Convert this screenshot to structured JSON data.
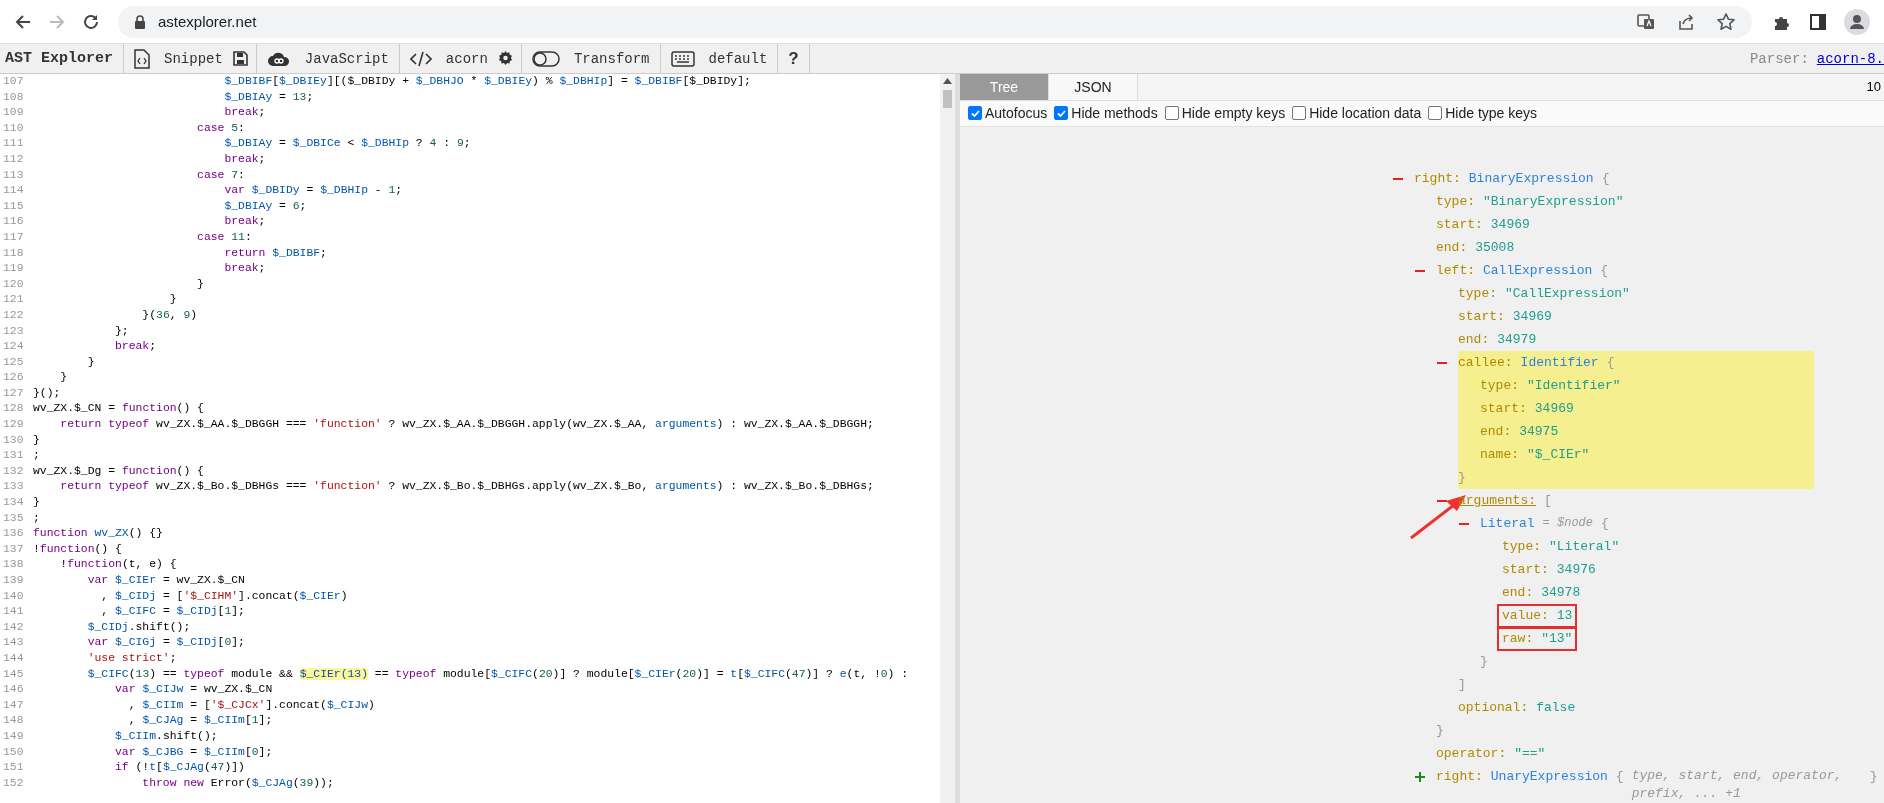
{
  "browser": {
    "nav": [
      {
        "kind": "back",
        "disabled": false
      },
      {
        "kind": "forward",
        "disabled": true
      },
      {
        "kind": "reload",
        "disabled": false
      }
    ],
    "url": "astexplorer.net",
    "actions": [
      {
        "kind": "translate"
      },
      {
        "kind": "share"
      },
      {
        "kind": "star"
      },
      {
        "kind": "extensions"
      },
      {
        "kind": "sidebar"
      },
      {
        "kind": "profile"
      }
    ]
  },
  "app_title": "AST Explorer",
  "toolbar": [
    [
      {
        "kind": "snippet",
        "label": "Snippet"
      },
      {
        "kind": "save"
      }
    ],
    [
      {
        "kind": "language",
        "label": "JavaScript"
      }
    ],
    [
      {
        "kind": "parser",
        "label": "acorn"
      },
      {
        "kind": "settings"
      }
    ],
    [
      {
        "kind": "transform",
        "label": "Transform"
      }
    ],
    [
      {
        "kind": "keymap",
        "label": "default"
      }
    ],
    [
      {
        "kind": "help",
        "label": "?"
      }
    ]
  ],
  "parser": {
    "label": "Parser:",
    "link": "acorn-8."
  },
  "code_lines": [
    {
      "no": "107",
      "seg": [
        {
          "kind": "v",
          "text": "                            $_DBIBF"
        },
        {
          "kind": "p",
          "text": "["
        },
        {
          "kind": "v",
          "text": "$_DBIEy"
        },
        {
          "kind": "p",
          "text": "][($_DBIDy + "
        },
        {
          "kind": "v",
          "text": "$_DBHJO"
        },
        {
          "kind": "p",
          "text": " * "
        },
        {
          "kind": "v",
          "text": "$_DBIEy"
        },
        {
          "kind": "p",
          "text": ") % "
        },
        {
          "kind": "v",
          "text": "$_DBHIp"
        },
        {
          "kind": "p",
          "text": "] = "
        },
        {
          "kind": "v",
          "text": "$_DBIBF"
        },
        {
          "kind": "p",
          "text": "[$_DBIDy];"
        }
      ]
    },
    {
      "no": "108",
      "seg": [
        {
          "kind": "v",
          "text": "                            $_DBIAy"
        },
        {
          "kind": "p",
          "text": " = "
        },
        {
          "kind": "n",
          "text": "13"
        },
        {
          "kind": "p",
          "text": ";"
        }
      ]
    },
    {
      "no": "109",
      "seg": [
        {
          "kind": "k",
          "text": "                            break"
        },
        {
          "kind": "p",
          "text": ";"
        }
      ]
    },
    {
      "no": "110",
      "seg": [
        {
          "kind": "k",
          "text": "                        case "
        },
        {
          "kind": "n",
          "text": "5"
        },
        {
          "kind": "p",
          "text": ":"
        }
      ]
    },
    {
      "no": "111",
      "seg": [
        {
          "kind": "v",
          "text": "                            $_DBIAy"
        },
        {
          "kind": "p",
          "text": " = "
        },
        {
          "kind": "v",
          "text": "$_DBICe"
        },
        {
          "kind": "p",
          "text": " < "
        },
        {
          "kind": "v",
          "text": "$_DBHIp"
        },
        {
          "kind": "p",
          "text": " ? "
        },
        {
          "kind": "n",
          "text": "4"
        },
        {
          "kind": "p",
          "text": " : "
        },
        {
          "kind": "n",
          "text": "9"
        },
        {
          "kind": "p",
          "text": ";"
        }
      ]
    },
    {
      "no": "112",
      "seg": [
        {
          "kind": "k",
          "text": "                            break"
        },
        {
          "kind": "p",
          "text": ";"
        }
      ]
    },
    {
      "no": "113",
      "seg": [
        {
          "kind": "k",
          "text": "                        case "
        },
        {
          "kind": "n",
          "text": "7"
        },
        {
          "kind": "p",
          "text": ":"
        }
      ]
    },
    {
      "no": "114",
      "seg": [
        {
          "kind": "k",
          "text": "                            var "
        },
        {
          "kind": "v",
          "text": "$_DBIDy"
        },
        {
          "kind": "p",
          "text": " = "
        },
        {
          "kind": "v",
          "text": "$_DBHIp"
        },
        {
          "kind": "p",
          "text": " - "
        },
        {
          "kind": "n",
          "text": "1"
        },
        {
          "kind": "p",
          "text": ";"
        }
      ]
    },
    {
      "no": "115",
      "seg": [
        {
          "kind": "v",
          "text": "                            $_DBIAy"
        },
        {
          "kind": "p",
          "text": " = "
        },
        {
          "kind": "n",
          "text": "6"
        },
        {
          "kind": "p",
          "text": ";"
        }
      ]
    },
    {
      "no": "116",
      "seg": [
        {
          "kind": "k",
          "text": "                            break"
        },
        {
          "kind": "p",
          "text": ";"
        }
      ]
    },
    {
      "no": "117",
      "seg": [
        {
          "kind": "k",
          "text": "                        case "
        },
        {
          "kind": "n",
          "text": "11"
        },
        {
          "kind": "p",
          "text": ":"
        }
      ]
    },
    {
      "no": "118",
      "seg": [
        {
          "kind": "k",
          "text": "                            return "
        },
        {
          "kind": "v",
          "text": "$_DBIBF"
        },
        {
          "kind": "p",
          "text": ";"
        }
      ]
    },
    {
      "no": "119",
      "seg": [
        {
          "kind": "k",
          "text": "                            break"
        },
        {
          "kind": "p",
          "text": ";"
        }
      ]
    },
    {
      "no": "120",
      "seg": [
        {
          "kind": "p",
          "text": "                        }"
        }
      ]
    },
    {
      "no": "121",
      "seg": [
        {
          "kind": "p",
          "text": "                    }"
        }
      ]
    },
    {
      "no": "122",
      "seg": [
        {
          "kind": "p",
          "text": "                }("
        },
        {
          "kind": "n",
          "text": "36"
        },
        {
          "kind": "p",
          "text": ", "
        },
        {
          "kind": "n",
          "text": "9"
        },
        {
          "kind": "p",
          "text": ")"
        }
      ]
    },
    {
      "no": "123",
      "seg": [
        {
          "kind": "p",
          "text": "            };"
        }
      ]
    },
    {
      "no": "124",
      "seg": [
        {
          "kind": "k",
          "text": "            break"
        },
        {
          "kind": "p",
          "text": ";"
        }
      ]
    },
    {
      "no": "125",
      "seg": [
        {
          "kind": "p",
          "text": "        }"
        }
      ]
    },
    {
      "no": "126",
      "seg": [
        {
          "kind": "p",
          "text": "    }"
        }
      ]
    },
    {
      "no": "127",
      "seg": [
        {
          "kind": "p",
          "text": "}();"
        }
      ]
    },
    {
      "no": "128",
      "seg": [
        {
          "kind": "p",
          "text": "wv_ZX.$_CN = "
        },
        {
          "kind": "k",
          "text": "function"
        },
        {
          "kind": "p",
          "text": "() {"
        }
      ]
    },
    {
      "no": "129",
      "seg": [
        {
          "kind": "k",
          "text": "    return typeof"
        },
        {
          "kind": "p",
          "text": " wv_ZX.$_AA.$_DBGGH === "
        },
        {
          "kind": "s",
          "text": "'function'"
        },
        {
          "kind": "p",
          "text": " ? wv_ZX.$_AA.$_DBGGH.apply(wv_ZX.$_AA, "
        },
        {
          "kind": "v",
          "text": "arguments"
        },
        {
          "kind": "p",
          "text": ") : wv_ZX.$_AA.$_DBGGH;"
        }
      ]
    },
    {
      "no": "130",
      "seg": [
        {
          "kind": "p",
          "text": "}"
        }
      ]
    },
    {
      "no": "131",
      "seg": [
        {
          "kind": "p",
          "text": ";"
        }
      ]
    },
    {
      "no": "132",
      "seg": [
        {
          "kind": "p",
          "text": "wv_ZX.$_Dg = "
        },
        {
          "kind": "k",
          "text": "function"
        },
        {
          "kind": "p",
          "text": "() {"
        }
      ]
    },
    {
      "no": "133",
      "seg": [
        {
          "kind": "k",
          "text": "    return typeof"
        },
        {
          "kind": "p",
          "text": " wv_ZX.$_Bo.$_DBHGs === "
        },
        {
          "kind": "s",
          "text": "'function'"
        },
        {
          "kind": "p",
          "text": " ? wv_ZX.$_Bo.$_DBHGs.apply(wv_ZX.$_Bo, "
        },
        {
          "kind": "v",
          "text": "arguments"
        },
        {
          "kind": "p",
          "text": ") : wv_ZX.$_Bo.$_DBHGs;"
        }
      ]
    },
    {
      "no": "134",
      "seg": [
        {
          "kind": "p",
          "text": "}"
        }
      ]
    },
    {
      "no": "135",
      "seg": [
        {
          "kind": "p",
          "text": ";"
        }
      ]
    },
    {
      "no": "136",
      "seg": [
        {
          "kind": "k",
          "text": "function "
        },
        {
          "kind": "v",
          "text": "wv_ZX"
        },
        {
          "kind": "p",
          "text": "() {}"
        }
      ]
    },
    {
      "no": "137",
      "seg": [
        {
          "kind": "p",
          "text": "!"
        },
        {
          "kind": "k",
          "text": "function"
        },
        {
          "kind": "p",
          "text": "() {"
        }
      ]
    },
    {
      "no": "138",
      "seg": [
        {
          "kind": "p",
          "text": "    !"
        },
        {
          "kind": "k",
          "text": "function"
        },
        {
          "kind": "p",
          "text": "(t, e) {"
        }
      ]
    },
    {
      "no": "139",
      "seg": [
        {
          "kind": "k",
          "text": "        var "
        },
        {
          "kind": "v",
          "text": "$_CIEr"
        },
        {
          "kind": "p",
          "text": " = wv_ZX.$_CN"
        }
      ]
    },
    {
      "no": "140",
      "seg": [
        {
          "kind": "p",
          "text": "          , "
        },
        {
          "kind": "v",
          "text": "$_CIDj"
        },
        {
          "kind": "p",
          "text": " = ["
        },
        {
          "kind": "s",
          "text": "'$_CIHM'"
        },
        {
          "kind": "p",
          "text": "].concat("
        },
        {
          "kind": "v",
          "text": "$_CIEr"
        },
        {
          "kind": "p",
          "text": ")"
        }
      ]
    },
    {
      "no": "141",
      "seg": [
        {
          "kind": "p",
          "text": "          , "
        },
        {
          "kind": "v",
          "text": "$_CIFC"
        },
        {
          "kind": "p",
          "text": " = "
        },
        {
          "kind": "v",
          "text": "$_CIDj"
        },
        {
          "kind": "p",
          "text": "["
        },
        {
          "kind": "n",
          "text": "1"
        },
        {
          "kind": "p",
          "text": "];"
        }
      ]
    },
    {
      "no": "142",
      "seg": [
        {
          "kind": "v",
          "text": "        $_CIDj"
        },
        {
          "kind": "p",
          "text": ".shift();"
        }
      ]
    },
    {
      "no": "143",
      "seg": [
        {
          "kind": "k",
          "text": "        var "
        },
        {
          "kind": "v",
          "text": "$_CIGj"
        },
        {
          "kind": "p",
          "text": " = "
        },
        {
          "kind": "v",
          "text": "$_CIDj"
        },
        {
          "kind": "p",
          "text": "["
        },
        {
          "kind": "n",
          "text": "0"
        },
        {
          "kind": "p",
          "text": "];"
        }
      ]
    },
    {
      "no": "144",
      "seg": [
        {
          "kind": "s",
          "text": "        'use strict'"
        },
        {
          "kind": "p",
          "text": ";"
        }
      ]
    },
    {
      "no": "145",
      "seg": [
        {
          "kind": "v",
          "text": "        $_CIFC"
        },
        {
          "kind": "p",
          "text": "("
        },
        {
          "kind": "n",
          "text": "13"
        },
        {
          "kind": "p",
          "text": ") == "
        },
        {
          "kind": "k",
          "text": "typeof"
        },
        {
          "kind": "p",
          "text": " module && "
        },
        {
          "kind": "h",
          "text": "$_CIEr(13)"
        },
        {
          "kind": "p",
          "text": " == "
        },
        {
          "kind": "k",
          "text": "typeof"
        },
        {
          "kind": "p",
          "text": " module["
        },
        {
          "kind": "v",
          "text": "$_CIFC"
        },
        {
          "kind": "p",
          "text": "("
        },
        {
          "kind": "n",
          "text": "20"
        },
        {
          "kind": "p",
          "text": ")] ? module["
        },
        {
          "kind": "v",
          "text": "$_CIEr"
        },
        {
          "kind": "p",
          "text": "("
        },
        {
          "kind": "n",
          "text": "20"
        },
        {
          "kind": "p",
          "text": ")] = "
        },
        {
          "kind": "v",
          "text": "t"
        },
        {
          "kind": "p",
          "text": "["
        },
        {
          "kind": "v",
          "text": "$_CIFC"
        },
        {
          "kind": "p",
          "text": "("
        },
        {
          "kind": "n",
          "text": "47"
        },
        {
          "kind": "p",
          "text": ")] ? "
        },
        {
          "kind": "v",
          "text": "e"
        },
        {
          "kind": "p",
          "text": "(t, !"
        },
        {
          "kind": "n",
          "text": "0"
        },
        {
          "kind": "p",
          "text": ") :"
        }
      ]
    },
    {
      "no": "146",
      "seg": [
        {
          "kind": "k",
          "text": "            var "
        },
        {
          "kind": "v",
          "text": "$_CIJw"
        },
        {
          "kind": "p",
          "text": " = wv_ZX.$_CN"
        }
      ]
    },
    {
      "no": "147",
      "seg": [
        {
          "kind": "p",
          "text": "              , "
        },
        {
          "kind": "v",
          "text": "$_CIIm"
        },
        {
          "kind": "p",
          "text": " = ["
        },
        {
          "kind": "s",
          "text": "'$_CJCx'"
        },
        {
          "kind": "p",
          "text": "].concat("
        },
        {
          "kind": "v",
          "text": "$_CIJw"
        },
        {
          "kind": "p",
          "text": ")"
        }
      ]
    },
    {
      "no": "148",
      "seg": [
        {
          "kind": "p",
          "text": "              , "
        },
        {
          "kind": "v",
          "text": "$_CJAg"
        },
        {
          "kind": "p",
          "text": " = "
        },
        {
          "kind": "v",
          "text": "$_CIIm"
        },
        {
          "kind": "p",
          "text": "["
        },
        {
          "kind": "n",
          "text": "1"
        },
        {
          "kind": "p",
          "text": "];"
        }
      ]
    },
    {
      "no": "149",
      "seg": [
        {
          "kind": "v",
          "text": "            $_CIIm"
        },
        {
          "kind": "p",
          "text": ".shift();"
        }
      ]
    },
    {
      "no": "150",
      "seg": [
        {
          "kind": "k",
          "text": "            var "
        },
        {
          "kind": "v",
          "text": "$_CJBG"
        },
        {
          "kind": "p",
          "text": " = "
        },
        {
          "kind": "v",
          "text": "$_CIIm"
        },
        {
          "kind": "p",
          "text": "["
        },
        {
          "kind": "n",
          "text": "0"
        },
        {
          "kind": "p",
          "text": "];"
        }
      ]
    },
    {
      "no": "151",
      "seg": [
        {
          "kind": "k",
          "text": "            if"
        },
        {
          "kind": "p",
          "text": " (!"
        },
        {
          "kind": "v",
          "text": "t"
        },
        {
          "kind": "p",
          "text": "["
        },
        {
          "kind": "v",
          "text": "$_CJAg"
        },
        {
          "kind": "p",
          "text": "("
        },
        {
          "kind": "n",
          "text": "47"
        },
        {
          "kind": "p",
          "text": ")])"
        }
      ]
    },
    {
      "no": "152",
      "seg": [
        {
          "kind": "k",
          "text": "                throw new"
        },
        {
          "kind": "p",
          "text": " Error("
        },
        {
          "kind": "v",
          "text": "$_CJAg"
        },
        {
          "kind": "p",
          "text": "("
        },
        {
          "kind": "n",
          "text": "39"
        },
        {
          "kind": "p",
          "text": "));"
        }
      ]
    }
  ],
  "tabs": [
    {
      "label": "Tree",
      "selected": true
    },
    {
      "label": "JSON",
      "selected": false
    }
  ],
  "zoom_text": "10",
  "options": [
    {
      "label": "Autofocus",
      "checked": true
    },
    {
      "label": "Hide methods",
      "checked": true
    },
    {
      "label": "Hide empty keys",
      "checked": false
    },
    {
      "label": "Hide location data",
      "checked": false
    },
    {
      "label": "Hide type keys",
      "checked": false
    }
  ],
  "tree": [
    {
      "kind": "node",
      "key": "right:",
      "type": "BinaryExpression",
      "open": "{",
      "expanded": true,
      "children": [
        {
          "kind": "prop",
          "key": "type:",
          "value": "\"BinaryExpression\""
        },
        {
          "kind": "prop",
          "key": "start:",
          "value": "34969"
        },
        {
          "kind": "prop",
          "key": "end:",
          "value": "35008"
        },
        {
          "kind": "node",
          "key": "left:",
          "type": "CallExpression",
          "open": "{",
          "close": "}",
          "expanded": true,
          "children": [
            {
              "kind": "prop",
              "key": "type:",
              "value": "\"CallExpression\""
            },
            {
              "kind": "prop",
              "key": "start:",
              "value": "34969"
            },
            {
              "kind": "prop",
              "key": "end:",
              "value": "34979"
            },
            {
              "kind": "node",
              "key": "callee:",
              "type": "Identifier",
              "open": "{",
              "close": "}",
              "expanded": true,
              "highlighted": true,
              "children": [
                {
                  "kind": "prop",
                  "key": "type:",
                  "value": "\"Identifier\""
                },
                {
                  "kind": "prop",
                  "key": "start:",
                  "value": "34969"
                },
                {
                  "kind": "prop",
                  "key": "end:",
                  "value": "34975"
                },
                {
                  "kind": "prop",
                  "key": "name:",
                  "value": "\"$_CIEr\""
                }
              ]
            },
            {
              "kind": "node",
              "key": "arguments:",
              "open": "[",
              "close": "]",
              "expanded": true,
              "highlighted": false,
              "annotated": true,
              "children": [
                {
                  "kind": "node",
                  "type": "Literal",
                  "note": "= $node",
                  "open": "{",
                  "close": "}",
                  "expanded": true,
                  "children": [
                    {
                      "kind": "prop",
                      "key": "type:",
                      "value": "\"Literal\"",
                      "boxed": false
                    },
                    {
                      "kind": "prop",
                      "key": "start:",
                      "value": "34976",
                      "boxed": false
                    },
                    {
                      "kind": "prop",
                      "key": "end:",
                      "value": "34978",
                      "boxed": false
                    },
                    {
                      "kind": "prop",
                      "key": "value:",
                      "value": "13",
                      "boxed": true
                    },
                    {
                      "kind": "prop",
                      "key": "raw:",
                      "value": "\"13\"",
                      "boxed": true
                    }
                  ]
                }
              ]
            },
            {
              "kind": "prop",
              "key": "optional:",
              "value": "false"
            }
          ]
        },
        {
          "kind": "prop",
          "key": "operator:",
          "value": "\"==\""
        },
        {
          "kind": "node",
          "key": "right:",
          "type": "UnaryExpression",
          "open": "{",
          "close": "}",
          "summary": "type, start, end, operator, prefix, ... +1",
          "expanded": false
        }
      ]
    }
  ]
}
